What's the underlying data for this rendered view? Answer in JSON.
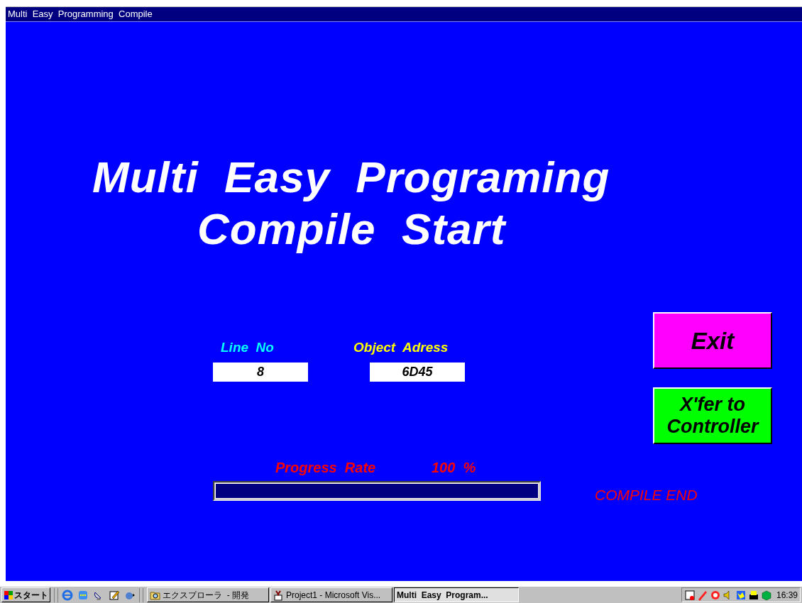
{
  "window": {
    "title": "Multi  Easy  Programming  Compile"
  },
  "heading": [
    "Multi  Easy  Programing",
    "Compile  Start"
  ],
  "fields": [
    {
      "label": "Line  No",
      "value": "8",
      "color": "#00ffff"
    },
    {
      "label": "Object  Adress",
      "value": "6D45",
      "color": "#ffff00"
    }
  ],
  "buttons": [
    {
      "label": "Exit",
      "color": "#ff00ff"
    },
    {
      "label": "X'fer to\nController",
      "color": "#00ff00"
    }
  ],
  "progress": {
    "label": "Progress  Rate",
    "reading": "100  %",
    "level": 1
  },
  "status": "COMPILE END",
  "taskbar": {
    "start": "スタート",
    "tasks": [
      {
        "label": "エクスプローラ  - 開発",
        "selected": false
      },
      {
        "label": "Project1 - Microsoft Vis...",
        "selected": false
      },
      {
        "label": "Multi  Easy  Program...",
        "selected": true
      }
    ],
    "clock": "16:39"
  }
}
